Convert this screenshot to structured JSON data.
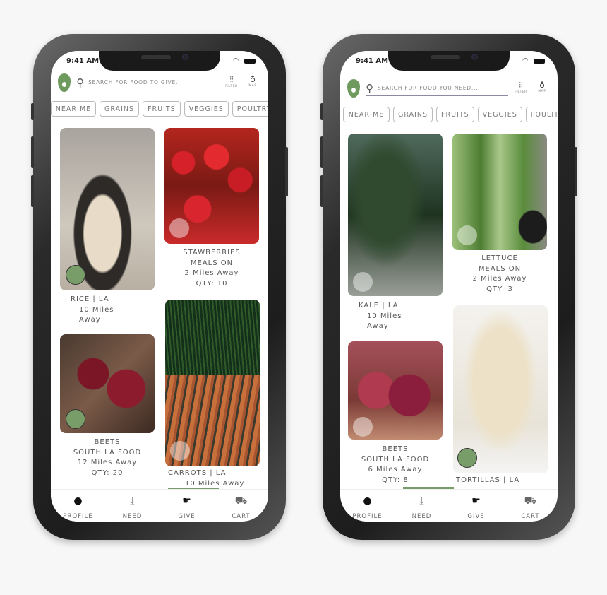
{
  "status_time": "9:41 AM",
  "nav": [
    "PROFILE",
    "NEED",
    "GIVE",
    "CART"
  ],
  "chips": [
    "NEAR ME",
    "GRAINS",
    "FRUITS",
    "VEGGIES",
    "POULTRY"
  ],
  "header_icons": {
    "filter": "FILTER",
    "map": "MAP"
  },
  "accent_color": "#789d69",
  "give_screen": {
    "search_placeholder": "SEARCH FOR FOOD TO GIVE...",
    "cards": [
      {
        "lines": [
          "RICE | LA",
          "10 Miles",
          "Away"
        ]
      },
      {
        "lines": [
          "STAWBERRIES",
          "MEALS ON",
          "2 Miles Away",
          "QTY: 10"
        ]
      },
      {
        "lines": [
          "BEETS",
          "SOUTH LA FOOD",
          "12 Miles Away",
          "QTY: 20"
        ]
      },
      {
        "lines": [
          "CARROTS | LA",
          "10 Miles Away"
        ]
      }
    ]
  },
  "need_screen": {
    "search_placeholder": "SEARCH FOR FOOD YOU NEED...",
    "cards": [
      {
        "lines": [
          "KALE | LA",
          "10 Miles",
          "Away"
        ]
      },
      {
        "lines": [
          "LETTUCE",
          "MEALS ON",
          "2 Miles Away",
          "QTY: 3"
        ]
      },
      {
        "lines": [
          "BEETS",
          "SOUTH LA FOOD",
          "6 Miles Away",
          "QTY: 8"
        ]
      },
      {
        "lines": [
          "TORTILLAS | LA"
        ]
      }
    ]
  }
}
